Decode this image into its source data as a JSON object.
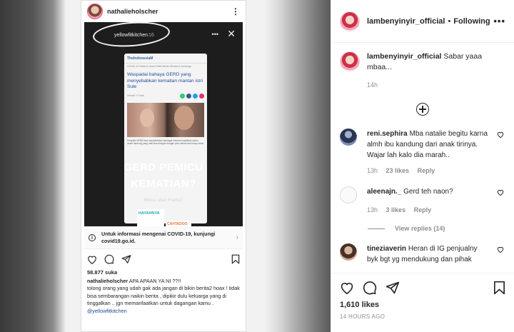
{
  "embedded_post": {
    "username": "nathalieholscher",
    "story": {
      "username": "yellowfitkitchen",
      "time": "16",
      "article_site": "TheIndonesiaM",
      "article_tabs": "COVID-19   Fakta & Hoax   Politik   Berita   Hikmah & Keluarga",
      "article_title": "Waspadai bahaya GERD yang menyebabkan kematian mantan istri Sule",
      "article_meta": "Deviati Y. Panti",
      "article_body": "Penyakit GERD bisa menyebabkan berbagai macam komplikasi serius. Asam lambung yang naik bisa dicegah dengan pola makan dan hidup sehat.",
      "headline_1": "GERD PEMICU",
      "headline_2": "KEMATIAN?",
      "subheadline": "Mitos atau Fakta?",
      "tag_1": "HAYAHNYA",
      "tag_2": "CAHTADOO"
    },
    "covid_banner": "Untuk informasi mengenai COVID-19, kunjungi covid19.go.id.",
    "likes": "58.877 suka",
    "caption_user": "nathalieholscher",
    "caption_first": "APA APAAN YA NI ??!!",
    "caption_rest": "tolong orang yang udah gak ada jangan di bikin berita2 hoax ! tidak bisa sembarangan naikin berita , dipikir dulu keluarga yang di tinggalkan .. jgn memanfaatkan untuk dagangan kamu .",
    "caption_mention": "@yellowfitkitchen"
  },
  "panel": {
    "header": {
      "username": "lambenyinyir_official",
      "separator": "•",
      "follow_status": "Following",
      "more": "•••"
    },
    "caption": {
      "username": "lambenyinyir_official",
      "text": "Sabar yaaa mbaa...",
      "time": "14h"
    },
    "comments": [
      {
        "username": "reni.sephira",
        "text": "Mba natalie begitu karna almh ibu kandung dari anak tirinya. Wajar lah kalo dia marah..",
        "time": "13h",
        "likes": "23 likes",
        "reply": "Reply"
      },
      {
        "username": "aleenajn._",
        "text": "Gerd teh naon?",
        "time": "13h",
        "likes": "3 likes",
        "reply": "Reply",
        "view_replies": "View replies (14)"
      },
      {
        "username": "tineziaverin",
        "text": "Heran di IG penjualny byk bgt yg mendukung dan pihak"
      }
    ],
    "likes": "1,610 likes",
    "posted": "14 HOURS AGO"
  },
  "colors": {
    "text": "#262626",
    "muted": "#8e8e8e",
    "link": "#1a4a8a"
  }
}
